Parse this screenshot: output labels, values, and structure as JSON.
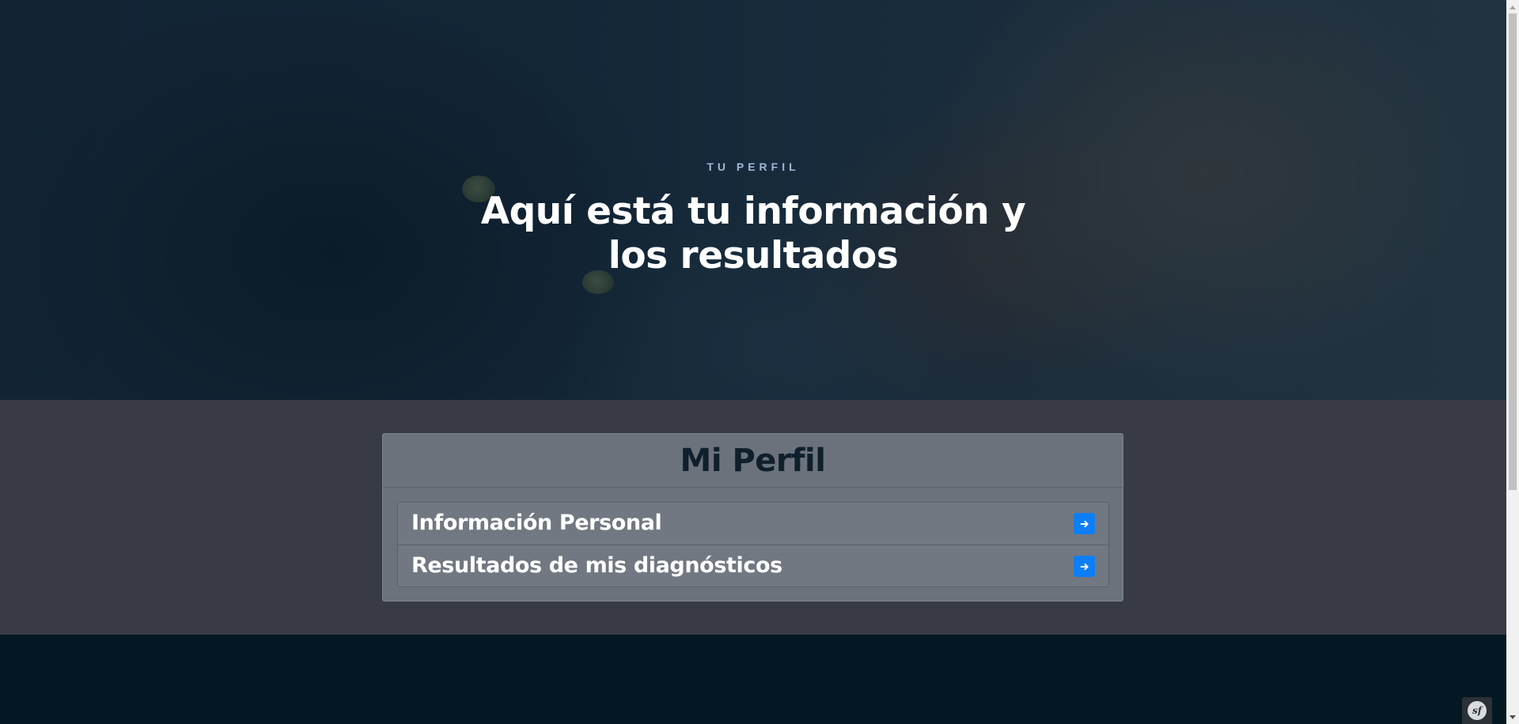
{
  "hero": {
    "kicker": "TU PERFIL",
    "title": "Aquí está tu información y los resultados"
  },
  "profile": {
    "title": "Mi Perfil",
    "items": [
      {
        "label": "Información Personal",
        "icon": "arrow-right-icon"
      },
      {
        "label": "Resultados de mis diagnósticos",
        "icon": "arrow-right-icon"
      }
    ]
  },
  "debug_toolbar": {
    "logo_text": "sf"
  },
  "colors": {
    "hero_overlay": "#112437",
    "kicker": "#9fb7da",
    "section_bg": "#383b44",
    "card_bg": "#6b727c",
    "card_title": "#0f1f2c",
    "button_accent": "#0d7ef5",
    "footer_bg": "#031822"
  }
}
